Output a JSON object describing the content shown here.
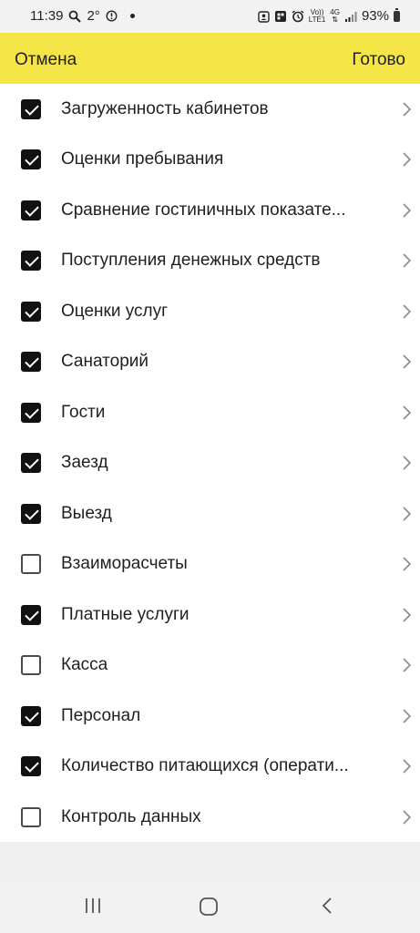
{
  "status_bar": {
    "time": "11:39",
    "temperature": "2°",
    "network_top": "4G",
    "volte": "Vo))",
    "lte": "LTE1",
    "battery": "93%"
  },
  "header": {
    "cancel_label": "Отмена",
    "done_label": "Готово",
    "background": "#f5e546"
  },
  "items": [
    {
      "label": "Загруженность кабинетов",
      "checked": true
    },
    {
      "label": "Оценки пребывания",
      "checked": true
    },
    {
      "label": "Сравнение гостиничных показате...",
      "checked": true
    },
    {
      "label": "Поступления денежных средств",
      "checked": true
    },
    {
      "label": "Оценки услуг",
      "checked": true
    },
    {
      "label": "Санаторий",
      "checked": true
    },
    {
      "label": "Гости",
      "checked": true
    },
    {
      "label": "Заезд",
      "checked": true
    },
    {
      "label": "Выезд",
      "checked": true
    },
    {
      "label": "Взаиморасчеты",
      "checked": false
    },
    {
      "label": "Платные услуги",
      "checked": true
    },
    {
      "label": "Касса",
      "checked": false
    },
    {
      "label": "Персонал",
      "checked": true
    },
    {
      "label": "Количество питающихся (операти...",
      "checked": true
    },
    {
      "label": "Контроль данных",
      "checked": false
    }
  ],
  "icons": {
    "row_chevron": "chevron-right-icon",
    "nav": [
      "recent-apps-icon",
      "home-icon",
      "back-icon"
    ]
  }
}
